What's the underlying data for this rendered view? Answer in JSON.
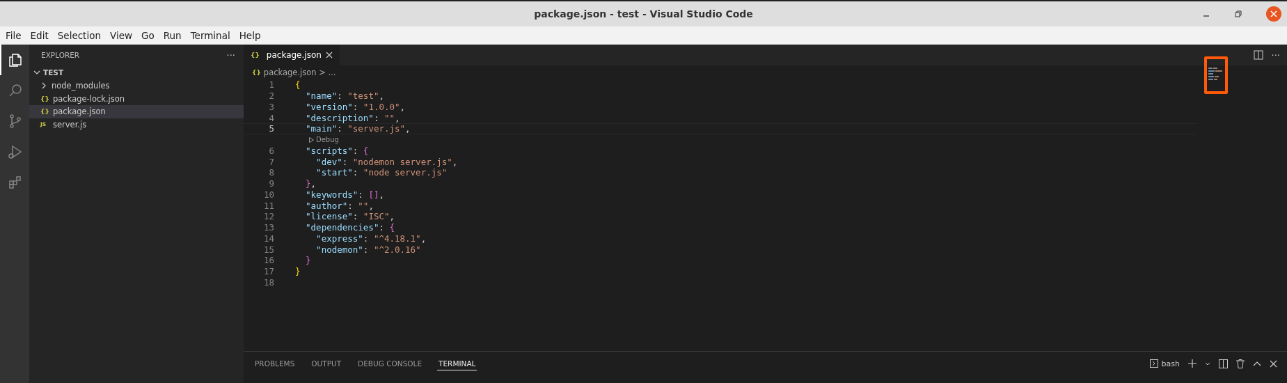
{
  "window": {
    "title": "package.json - test - Visual Studio Code"
  },
  "menu": [
    "File",
    "Edit",
    "Selection",
    "View",
    "Go",
    "Run",
    "Terminal",
    "Help"
  ],
  "activity_bar": [
    {
      "kind": "files",
      "selected": true
    },
    {
      "kind": "search",
      "selected": false
    },
    {
      "kind": "source-control",
      "selected": false
    },
    {
      "kind": "run",
      "selected": false
    },
    {
      "kind": "extensions",
      "selected": false
    }
  ],
  "sidebar": {
    "title": "EXPLORER",
    "more": "···",
    "folder": {
      "label": "TEST",
      "expanded": true,
      "children": [
        {
          "label": "node_modules",
          "kind": "folder",
          "expanded": false,
          "selected": false
        },
        {
          "label": "package-lock.json",
          "kind": "json",
          "badge": "{}",
          "selected": false
        },
        {
          "label": "package.json",
          "kind": "json",
          "badge": "{}",
          "selected": true
        },
        {
          "label": "server.js",
          "kind": "js",
          "badge": "JS",
          "selected": false
        }
      ]
    }
  },
  "editor": {
    "tabs": [
      {
        "label": "package.json",
        "badge": "{}",
        "selected": true
      }
    ],
    "more": "···",
    "breadcrumb": {
      "badge": "{}",
      "file": "package.json",
      "sep": ">",
      "rest": "..."
    },
    "lines": [
      {
        "number": "1",
        "current": false,
        "tokens": [
          {
            "kind": "brace1",
            "text": "{"
          }
        ]
      },
      {
        "number": "2",
        "current": false,
        "tokens": [
          {
            "kind": "key",
            "text": "  \"name\""
          },
          {
            "kind": "punct",
            "text": ": "
          },
          {
            "kind": "string",
            "text": "\"test\""
          },
          {
            "kind": "punct",
            "text": ","
          }
        ]
      },
      {
        "number": "3",
        "current": false,
        "tokens": [
          {
            "kind": "key",
            "text": "  \"version\""
          },
          {
            "kind": "punct",
            "text": ": "
          },
          {
            "kind": "string",
            "text": "\"1.0.0\""
          },
          {
            "kind": "punct",
            "text": ","
          }
        ]
      },
      {
        "number": "4",
        "current": false,
        "tokens": [
          {
            "kind": "key",
            "text": "  \"description\""
          },
          {
            "kind": "punct",
            "text": ": "
          },
          {
            "kind": "string",
            "text": "\"\""
          },
          {
            "kind": "punct",
            "text": ","
          }
        ]
      },
      {
        "number": "5",
        "current": true,
        "tokens": [
          {
            "kind": "key",
            "text": "  \"main\""
          },
          {
            "kind": "punct",
            "text": ": "
          },
          {
            "kind": "string",
            "text": "\"server.js\""
          },
          {
            "kind": "punct",
            "text": ","
          }
        ],
        "codelens": "Debug"
      },
      {
        "number": "6",
        "current": false,
        "tokens": [
          {
            "kind": "key",
            "text": "  \"scripts\""
          },
          {
            "kind": "punct",
            "text": ": "
          },
          {
            "kind": "brace2",
            "text": "{"
          }
        ]
      },
      {
        "number": "7",
        "current": false,
        "tokens": [
          {
            "kind": "key",
            "text": "    \"dev\""
          },
          {
            "kind": "punct",
            "text": ": "
          },
          {
            "kind": "string",
            "text": "\"nodemon server.js\""
          },
          {
            "kind": "punct",
            "text": ","
          }
        ]
      },
      {
        "number": "8",
        "current": false,
        "tokens": [
          {
            "kind": "key",
            "text": "    \"start\""
          },
          {
            "kind": "punct",
            "text": ": "
          },
          {
            "kind": "string",
            "text": "\"node server.js\""
          }
        ]
      },
      {
        "number": "9",
        "current": false,
        "tokens": [
          {
            "kind": "brace2",
            "text": "  }"
          },
          {
            "kind": "punct",
            "text": ","
          }
        ]
      },
      {
        "number": "10",
        "current": false,
        "tokens": [
          {
            "kind": "key",
            "text": "  \"keywords\""
          },
          {
            "kind": "punct",
            "text": ": "
          },
          {
            "kind": "brace2",
            "text": "[]"
          },
          {
            "kind": "punct",
            "text": ","
          }
        ]
      },
      {
        "number": "11",
        "current": false,
        "tokens": [
          {
            "kind": "key",
            "text": "  \"author\""
          },
          {
            "kind": "punct",
            "text": ": "
          },
          {
            "kind": "string",
            "text": "\"\""
          },
          {
            "kind": "punct",
            "text": ","
          }
        ]
      },
      {
        "number": "12",
        "current": false,
        "tokens": [
          {
            "kind": "key",
            "text": "  \"license\""
          },
          {
            "kind": "punct",
            "text": ": "
          },
          {
            "kind": "string",
            "text": "\"ISC\""
          },
          {
            "kind": "punct",
            "text": ","
          }
        ]
      },
      {
        "number": "13",
        "current": false,
        "tokens": [
          {
            "kind": "key",
            "text": "  \"dependencies\""
          },
          {
            "kind": "punct",
            "text": ": "
          },
          {
            "kind": "brace2",
            "text": "{"
          }
        ]
      },
      {
        "number": "14",
        "current": false,
        "tokens": [
          {
            "kind": "key",
            "text": "    \"express\""
          },
          {
            "kind": "punct",
            "text": ": "
          },
          {
            "kind": "string",
            "text": "\"^4.18.1\""
          },
          {
            "kind": "punct",
            "text": ","
          }
        ]
      },
      {
        "number": "15",
        "current": false,
        "tokens": [
          {
            "kind": "key",
            "text": "    \"nodemon\""
          },
          {
            "kind": "punct",
            "text": ": "
          },
          {
            "kind": "string",
            "text": "\"^2.0.16\""
          }
        ]
      },
      {
        "number": "16",
        "current": false,
        "tokens": [
          {
            "kind": "brace2",
            "text": "  }"
          }
        ]
      },
      {
        "number": "17",
        "current": false,
        "tokens": [
          {
            "kind": "brace1",
            "text": "}"
          }
        ]
      },
      {
        "number": "18",
        "current": false
      }
    ]
  },
  "panel": {
    "tabs": [
      {
        "label": "PROBLEMS",
        "selected": false
      },
      {
        "label": "OUTPUT",
        "selected": false
      },
      {
        "label": "DEBUG CONSOLE",
        "selected": false
      },
      {
        "label": "TERMINAL",
        "selected": true
      }
    ],
    "terminal_picker": "bash"
  }
}
